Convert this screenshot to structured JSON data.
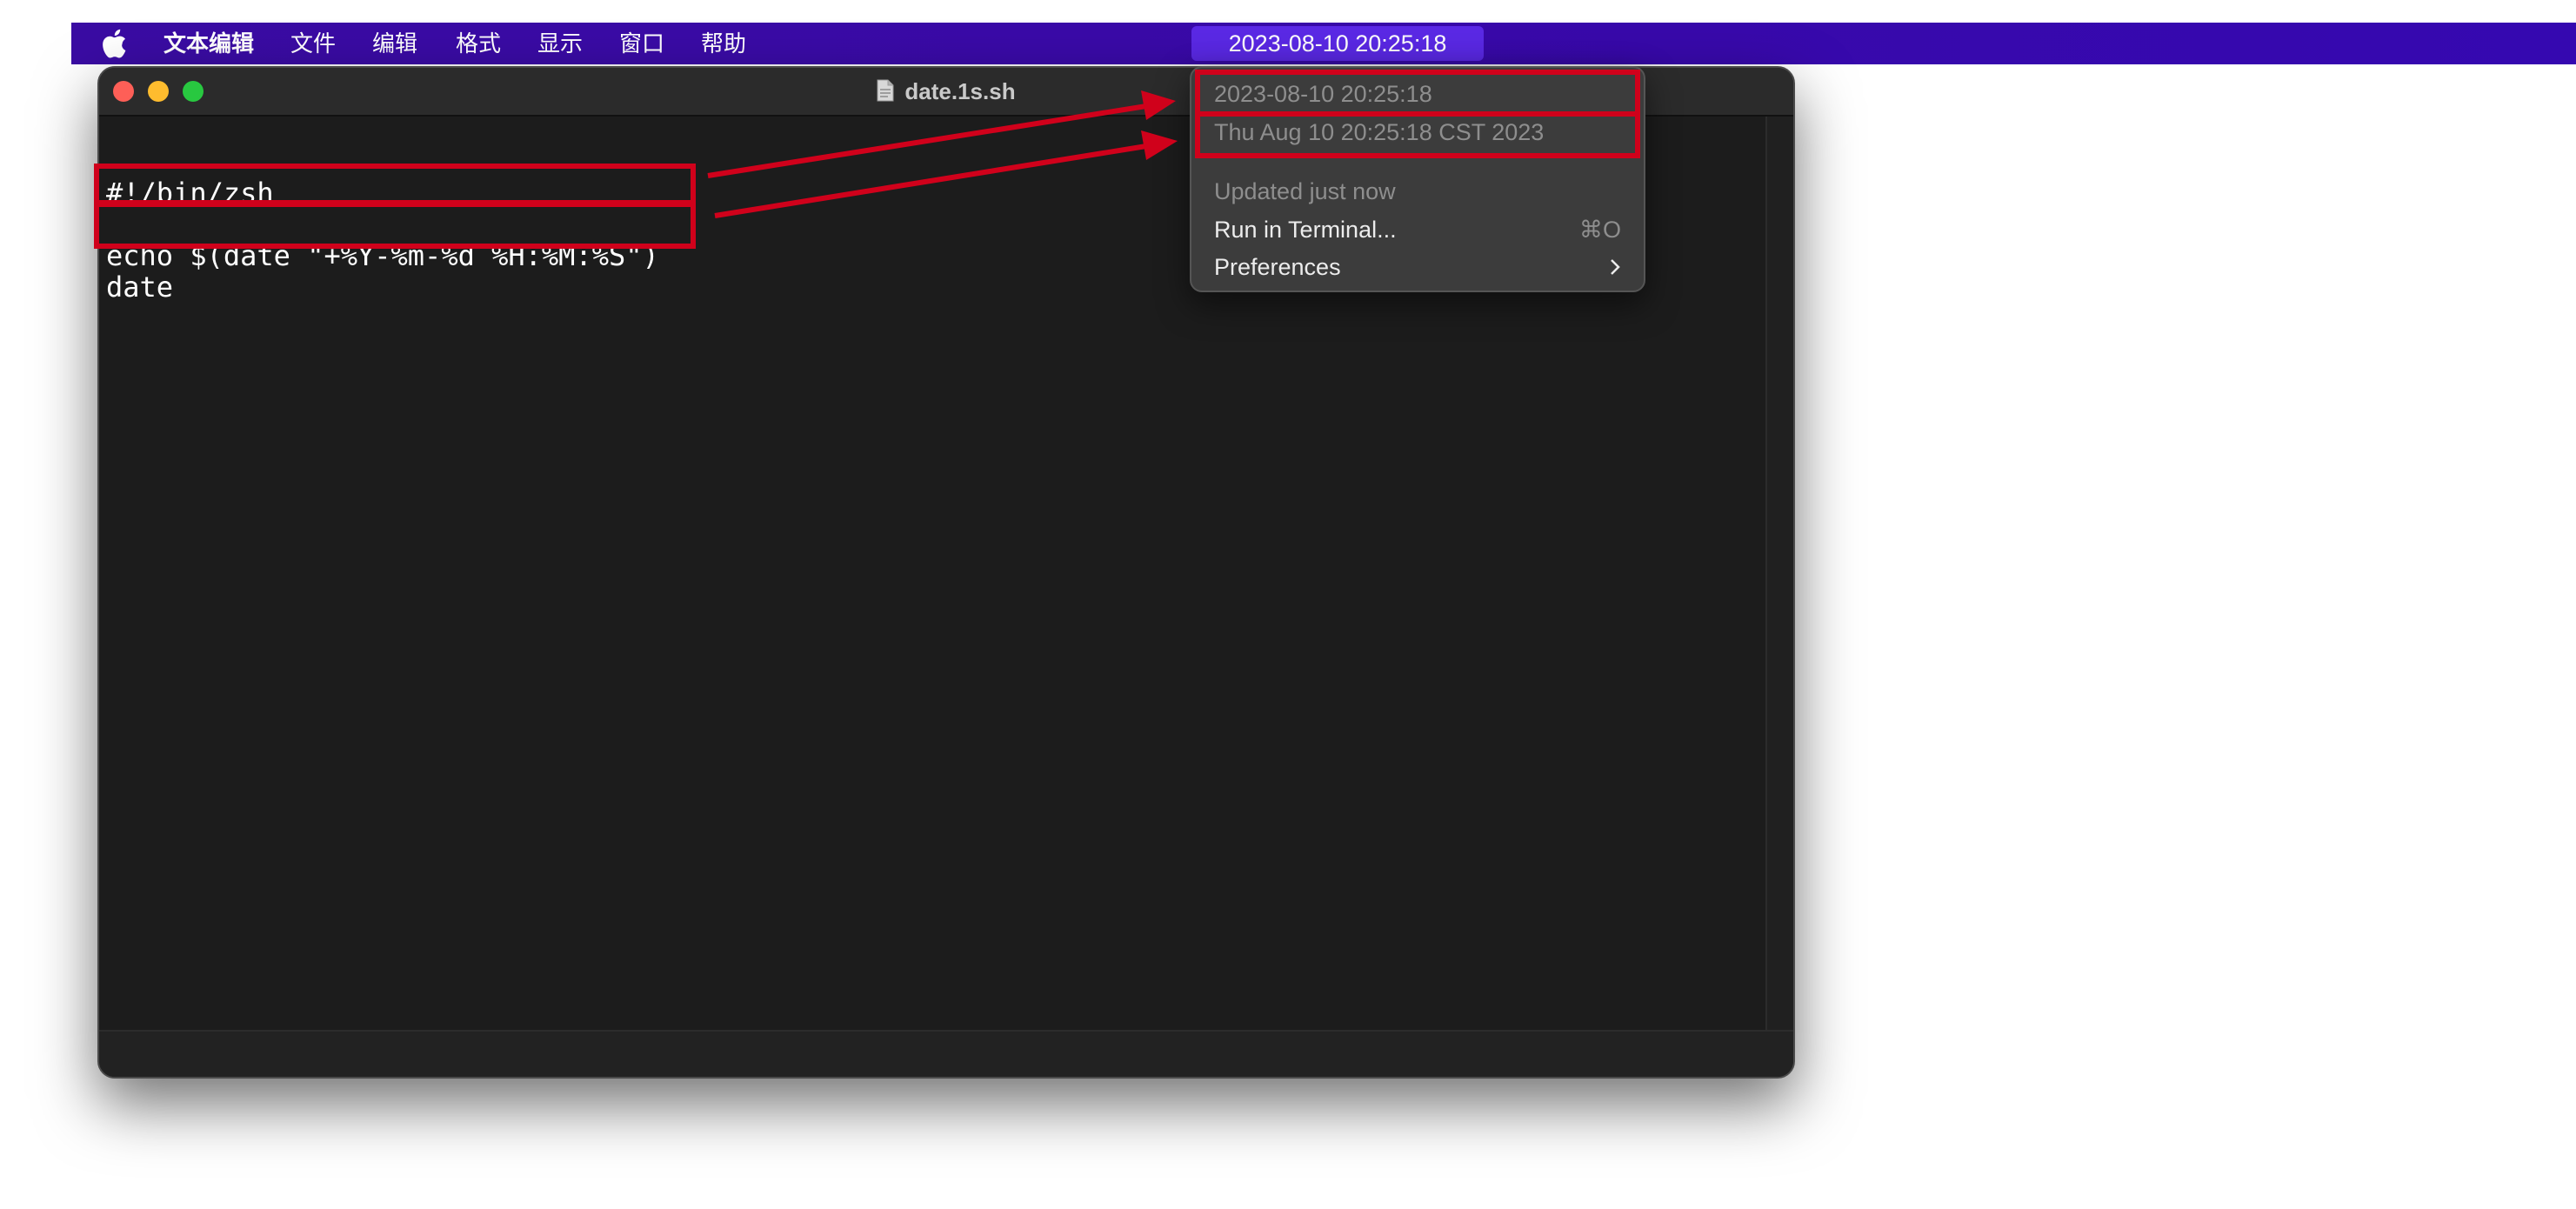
{
  "menubar": {
    "app_name": "文本编辑",
    "menus": [
      "文件",
      "编辑",
      "格式",
      "显示",
      "窗口",
      "帮助"
    ],
    "status_item": "2023-08-10 20:25:18"
  },
  "window": {
    "title": "date.1s.sh",
    "code_lines": [
      "#!/bin/zsh",
      "",
      "echo $(date \"+%Y-%m-%d %H:%M:%S\")",
      "date"
    ]
  },
  "dropdown": {
    "output_lines": [
      "2023-08-10 20:25:18",
      "Thu Aug 10 20:25:18 CST 2023"
    ],
    "updated": "Updated just now",
    "run_in_terminal": "Run in Terminal...",
    "run_shortcut": "⌘O",
    "preferences": "Preferences"
  },
  "colors": {
    "menubar": "#3a0ca3",
    "status_highlight": "#5b29e6",
    "annotation": "#d0011b",
    "close": "#fe5f57",
    "minimize": "#febc2e",
    "maximize": "#28c840"
  }
}
